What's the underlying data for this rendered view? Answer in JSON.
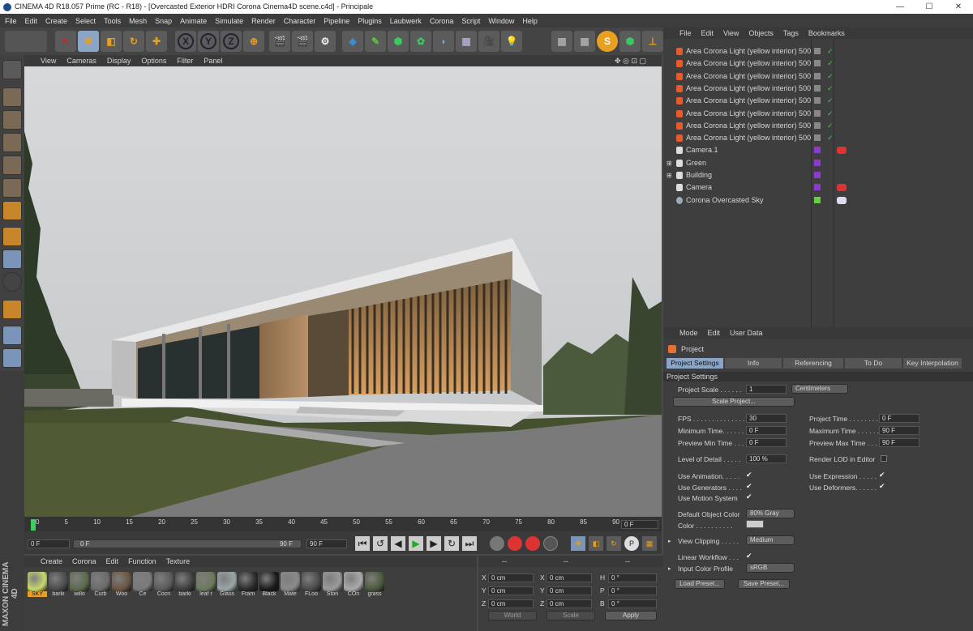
{
  "window": {
    "title": "CINEMA 4D R18.057 Prime (RC - R18) - [Overcasted Exterior HDRI  Corona Cinema4D scene.c4d] - Principale",
    "minimize": "—",
    "maximize": "☐",
    "close": "✕"
  },
  "menu": [
    "File",
    "Edit",
    "Create",
    "Select",
    "Tools",
    "Mesh",
    "Snap",
    "Animate",
    "Simulate",
    "Render",
    "Character",
    "Pipeline",
    "Plugins",
    "Laubwerk",
    "Corona",
    "Script",
    "Window",
    "Help"
  ],
  "toolbar": {
    "axis_x": "X",
    "axis_y": "Y",
    "axis_z": "Z",
    "snap": "S"
  },
  "viewport": {
    "menu": [
      "View",
      "Cameras",
      "Display",
      "Options",
      "Filter",
      "Panel"
    ]
  },
  "timeline": {
    "ticks": [
      "0",
      "5",
      "10",
      "15",
      "20",
      "25",
      "30",
      "35",
      "40",
      "45",
      "50",
      "55",
      "60",
      "65",
      "70",
      "75",
      "80",
      "85",
      "90"
    ],
    "current_frame": "0 F",
    "start_field": "0 F",
    "slider_left": "0 F",
    "slider_right": "90 F",
    "end_field": "90 F"
  },
  "materials": {
    "menu": [
      "Create",
      "Corona",
      "Edit",
      "Function",
      "Texture"
    ],
    "items": [
      {
        "label": "SKY",
        "color": "#c8d86a"
      },
      {
        "label": "barki",
        "color": "#4a4a4a"
      },
      {
        "label": "willo",
        "color": "#5b6a4a"
      },
      {
        "label": "Curb",
        "color": "#6a6a6a"
      },
      {
        "label": "Woo",
        "color": "#6a5540"
      },
      {
        "label": "Ce",
        "color": "#7a7a7a"
      },
      {
        "label": "Cocn",
        "color": "#5a5a5a"
      },
      {
        "label": "barki",
        "color": "#3e3e3e"
      },
      {
        "label": "leaf r",
        "color": "#6a7a5a"
      },
      {
        "label": "Glass",
        "color": "#9aa6a8"
      },
      {
        "label": "Fram",
        "color": "#2a2a2a"
      },
      {
        "label": "Black",
        "color": "#1a1a1a"
      },
      {
        "label": "Mate",
        "color": "#8a8a8a"
      },
      {
        "label": "FLoo",
        "color": "#4a4a4a"
      },
      {
        "label": "Ston",
        "color": "#9a9a9a"
      },
      {
        "label": "COn",
        "color": "#aaaaaa"
      },
      {
        "label": "grass",
        "color": "#4a5a3a"
      }
    ],
    "brand1": "MAXON",
    "brand2": "CINEMA 4D"
  },
  "coords": {
    "headers": [
      "--",
      "--",
      "--"
    ],
    "rows": [
      {
        "a": "X",
        "av": "0 cm",
        "b": "X",
        "bv": "0 cm",
        "c": "H",
        "cv": "0 °"
      },
      {
        "a": "Y",
        "av": "0 cm",
        "b": "Y",
        "bv": "0 cm",
        "c": "P",
        "cv": "0 °"
      },
      {
        "a": "Z",
        "av": "0 cm",
        "b": "Z",
        "bv": "0 cm",
        "c": "B",
        "cv": "0 °"
      }
    ],
    "mode": "World",
    "scale": "Scale",
    "apply": "Apply"
  },
  "objects": {
    "menu": [
      "File",
      "Edit",
      "View",
      "Objects",
      "Tags",
      "Bookmarks"
    ],
    "items": [
      {
        "name": "Area Corona Light (yellow interior) 500",
        "kind": "light"
      },
      {
        "name": "Area Corona Light (yellow interior) 500",
        "kind": "light"
      },
      {
        "name": "Area Corona Light (yellow interior) 500",
        "kind": "light"
      },
      {
        "name": "Area Corona Light (yellow interior) 500",
        "kind": "light"
      },
      {
        "name": "Area Corona Light (yellow interior) 500",
        "kind": "light"
      },
      {
        "name": "Area Corona Light (yellow interior) 500",
        "kind": "light"
      },
      {
        "name": "Area Corona Light (yellow interior) 500",
        "kind": "light"
      },
      {
        "name": "Area Corona Light (yellow interior) 500",
        "kind": "light"
      },
      {
        "name": "Camera.1",
        "kind": "camera"
      },
      {
        "name": "Green",
        "kind": "null"
      },
      {
        "name": "Building",
        "kind": "null"
      },
      {
        "name": "Camera",
        "kind": "camera"
      },
      {
        "name": "Corona Overcasted Sky",
        "kind": "sky"
      }
    ]
  },
  "attributes": {
    "menu": [
      "Mode",
      "Edit",
      "User Data"
    ],
    "title": "Project",
    "tabs": [
      "Project Settings",
      "Info",
      "Referencing",
      "To Do",
      "Key Interpolation"
    ],
    "section": "Project Settings",
    "project_scale_label": "Project Scale . . . . . .",
    "project_scale": "1",
    "scale_unit": "Centimeters",
    "scale_project_btn": "Scale Project...",
    "fps_label": "FPS . . . . . . . . . . . . . .",
    "fps": "30",
    "project_time_label": "Project Time . . . . . . . .",
    "project_time": "0 F",
    "min_time_label": "Minimum Time. . . . . . .",
    "min_time": "0 F",
    "max_time_label": "Maximum Time . . . . . .",
    "max_time": "90 F",
    "prev_min_label": "Preview Min Time . . .",
    "prev_min": "0 F",
    "prev_max_label": "Preview Max Time . . .",
    "prev_max": "90 F",
    "lod_label": "Level of Detail . . . . .",
    "lod": "100 %",
    "render_lod_label": "Render LOD in Editor",
    "use_anim_label": "Use Animation. . . . .",
    "use_expr_label": "Use Expression . . . . .",
    "use_gen_label": "Use Generators . . . .",
    "use_def_label": "Use Deformers. . . . . .",
    "use_motion_label": "Use Motion System",
    "def_color_label": "Default Object Color",
    "def_color": "80% Gray",
    "color_label": "Color . . . . . . . . . .",
    "view_clip_label": "View Clipping . . . . .",
    "view_clip": "Medium",
    "linear_label": "Linear Workflow . . .",
    "input_profile_label": "Input Color Profile",
    "input_profile": "sRGB",
    "load_preset": "Load Preset...",
    "save_preset": "Save Preset...",
    "check": "✔"
  }
}
